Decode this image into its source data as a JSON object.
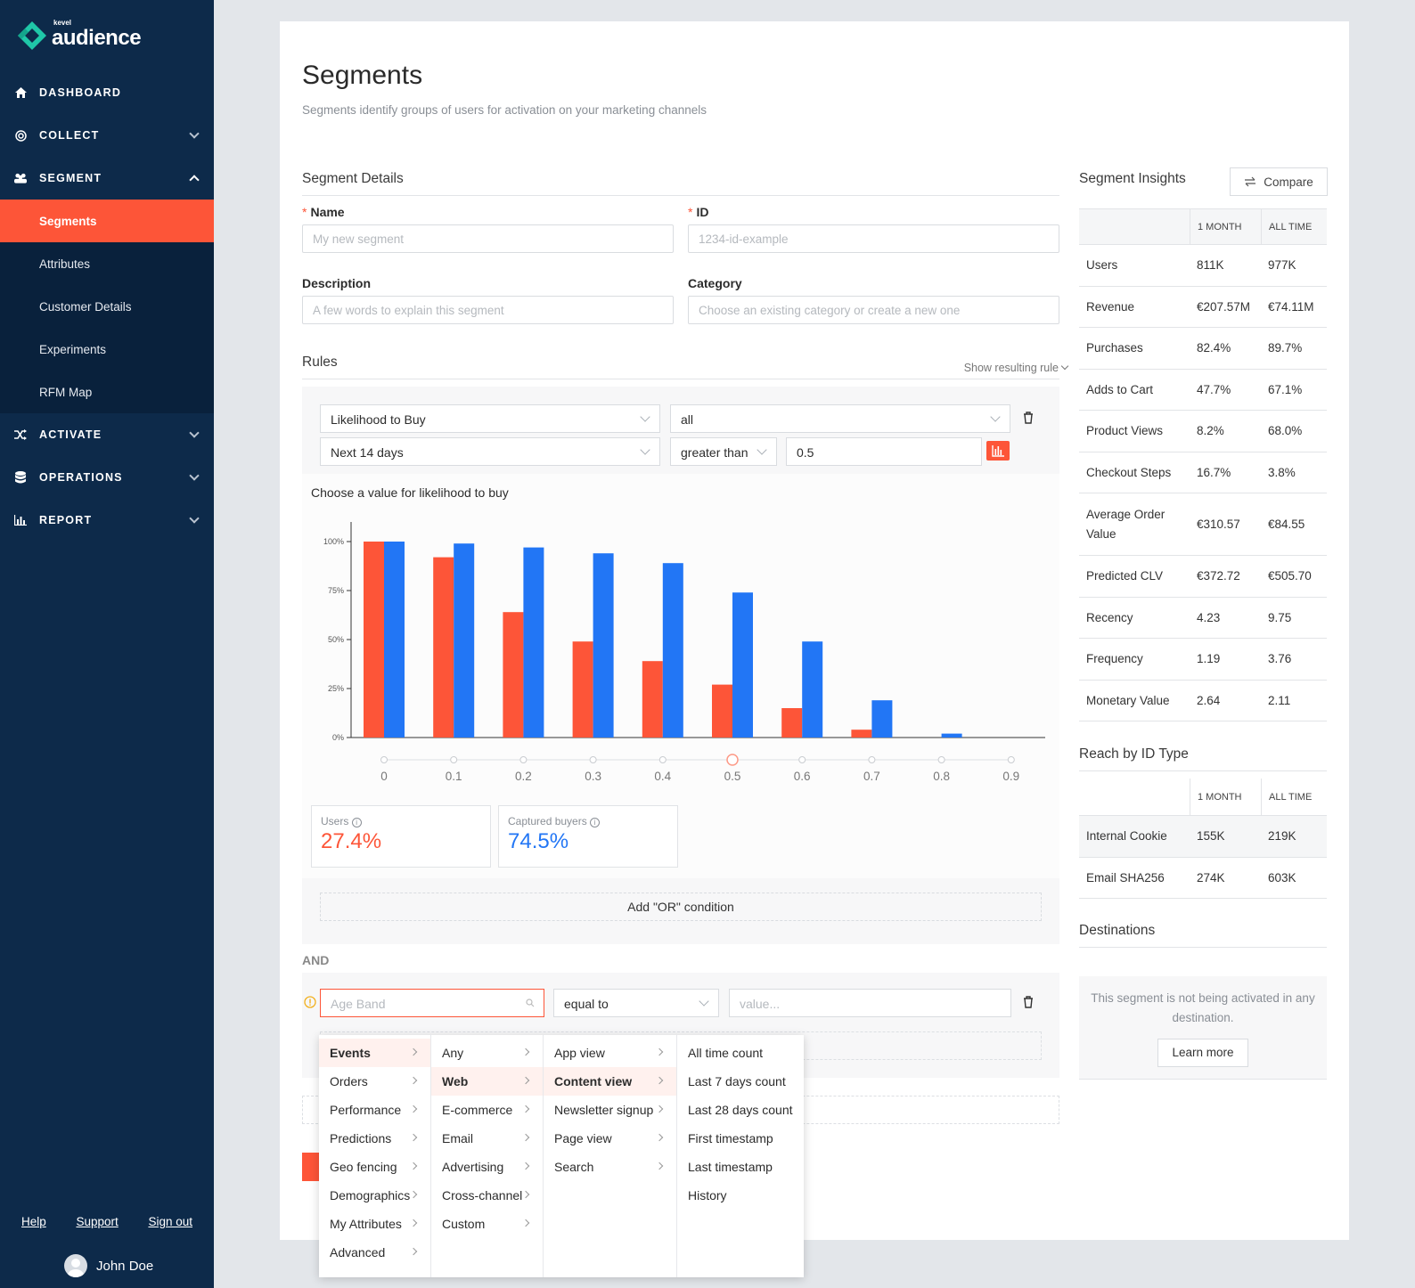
{
  "brand": {
    "small": "kevel",
    "name": "audience",
    "accent": "#fd5538",
    "teal": "#1fc7a8"
  },
  "nav": {
    "items": [
      {
        "label": "DASHBOARD",
        "icon": "home-icon"
      },
      {
        "label": "COLLECT",
        "icon": "target-icon"
      },
      {
        "label": "SEGMENT",
        "icon": "users-icon"
      },
      {
        "label": "ACTIVATE",
        "icon": "shuffle-icon"
      },
      {
        "label": "OPERATIONS",
        "icon": "database-icon"
      },
      {
        "label": "REPORT",
        "icon": "bar-chart-icon"
      }
    ],
    "sub": [
      "Segments",
      "Attributes",
      "Customer Details",
      "Experiments",
      "RFM Map"
    ]
  },
  "footer": {
    "help": "Help",
    "support": "Support",
    "signout": "Sign out",
    "user": "John Doe"
  },
  "page": {
    "title": "Segments",
    "subtitle": "Segments identify groups of users for activation on your marketing channels"
  },
  "details": {
    "heading": "Segment Details",
    "name_label": "Name",
    "name_placeholder": "My new segment",
    "id_label": "ID",
    "id_placeholder": "1234-id-example",
    "desc_label": "Description",
    "desc_placeholder": "A few words to explain this segment",
    "cat_label": "Category",
    "cat_placeholder": "Choose an existing category or create a new one",
    "required_mark": "*"
  },
  "rules": {
    "heading": "Rules",
    "show_rule": "Show resulting rule",
    "rule1": {
      "attribute": "Likelihood to Buy",
      "scope": "all",
      "period": "Next 14 days",
      "operator": "greater than",
      "value": "0.5"
    },
    "chart_title": "Choose a value for likelihood to buy",
    "users_label": "Users",
    "users_value": "27.4%",
    "buyers_label": "Captured buyers",
    "buyers_value": "74.5%",
    "add_or": "Add \"OR\" condition",
    "and_label": "AND",
    "rule2": {
      "attribute_placeholder": "Age Band",
      "operator": "equal to",
      "value_placeholder": "value..."
    }
  },
  "chart_data": {
    "type": "bar",
    "categories": [
      "0",
      "0.1",
      "0.2",
      "0.3",
      "0.4",
      "0.5",
      "0.6",
      "0.7",
      "0.8",
      "0.9"
    ],
    "series": [
      {
        "values": [
          100,
          92,
          64,
          49,
          39,
          27,
          15,
          4,
          0,
          0
        ],
        "color": "#fd5538"
      },
      {
        "values": [
          100,
          99,
          97,
          94,
          89,
          74,
          49,
          19,
          2,
          0
        ],
        "color": "#2276f5"
      }
    ],
    "yticks": [
      "0%",
      "25%",
      "50%",
      "75%",
      "100%"
    ],
    "ylim": [
      0,
      100
    ],
    "selected": "0.5"
  },
  "insights": {
    "heading": "Segment Insights",
    "compare": "Compare",
    "col1": "1 MONTH",
    "col2": "ALL TIME",
    "rows": [
      {
        "label": "Users",
        "m": "811K",
        "a": "977K"
      },
      {
        "label": "Revenue",
        "m": "€207.57M",
        "a": "€74.11M"
      },
      {
        "label": "Purchases",
        "m": "82.4%",
        "a": "89.7%"
      },
      {
        "label": "Adds to Cart",
        "m": "47.7%",
        "a": "67.1%"
      },
      {
        "label": "Product Views",
        "m": "8.2%",
        "a": "68.0%"
      },
      {
        "label": "Checkout Steps",
        "m": "16.7%",
        "a": "3.8%"
      },
      {
        "label": "Average Order Value",
        "m": "€310.57",
        "a": "€84.55"
      },
      {
        "label": "Predicted CLV",
        "m": "€372.72",
        "a": "€505.70"
      },
      {
        "label": "Recency",
        "m": "4.23",
        "a": "9.75"
      },
      {
        "label": "Frequency",
        "m": "1.19",
        "a": "3.76"
      },
      {
        "label": "Monetary Value",
        "m": "2.64",
        "a": "2.11"
      }
    ]
  },
  "reach": {
    "heading": "Reach by ID Type",
    "col1": "1 MONTH",
    "col2": "ALL TIME",
    "rows": [
      {
        "label": "Internal Cookie",
        "m": "155K",
        "a": "219K"
      },
      {
        "label": "Email SHA256",
        "m": "274K",
        "a": "603K"
      }
    ]
  },
  "destinations": {
    "heading": "Destinations",
    "text": "This segment is not being activated in any destination.",
    "learn": "Learn more"
  },
  "menu": {
    "col1": [
      "Events",
      "Orders",
      "Performance",
      "Predictions",
      "Geo fencing",
      "Demographics",
      "My Attributes",
      "Advanced"
    ],
    "col2": [
      "Any",
      "Web",
      "E-commerce",
      "Email",
      "Advertising",
      "Cross-channel",
      "Custom"
    ],
    "col3": [
      "App view",
      "Content view",
      "Newsletter signup",
      "Page view",
      "Search"
    ],
    "col4": [
      "All time count",
      "Last 7 days count",
      "Last 28 days count",
      "First timestamp",
      "Last timestamp",
      "History"
    ]
  }
}
